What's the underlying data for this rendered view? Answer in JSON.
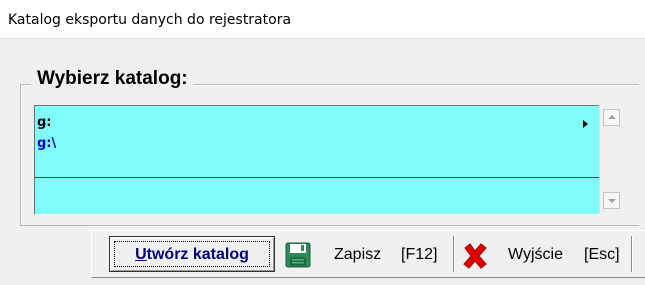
{
  "window": {
    "title": "Katalog eksportu danych do rejestratora"
  },
  "group": {
    "label": "Wybierz katalog:"
  },
  "list": {
    "items": [
      {
        "label": "g:"
      },
      {
        "label": "g:\\"
      }
    ]
  },
  "toolbar": {
    "create": {
      "label_underlined": "U",
      "label_rest": "twórz katalog"
    },
    "save": {
      "label": "Zapisz",
      "key": "[F12]",
      "icon": "floppy-disk-icon"
    },
    "exit": {
      "label": "Wyjście",
      "key": "[Esc]",
      "icon": "red-x-icon"
    }
  },
  "colors": {
    "list_background": "#7ffcfc",
    "selected_item_text": "#0000cc",
    "create_label": "#000080",
    "save_icon": "#2e8b57",
    "exit_icon": "#e00000"
  }
}
